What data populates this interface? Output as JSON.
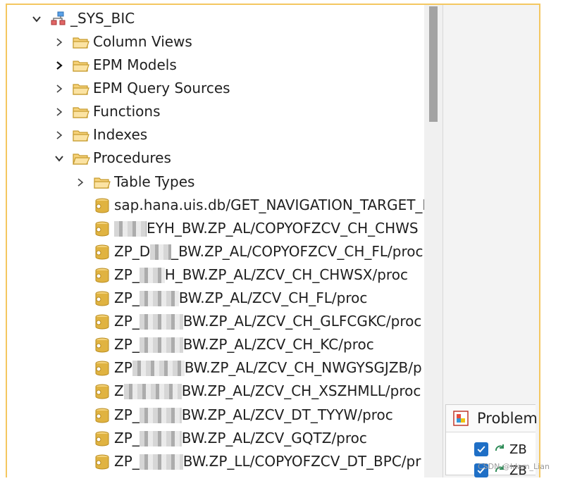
{
  "tree": {
    "root_label": "_SYS_BIC",
    "folders": [
      {
        "label": "Column Views",
        "state": "collapsed"
      },
      {
        "label": "EPM Models",
        "state": "collapsed"
      },
      {
        "label": "EPM Query Sources",
        "state": "collapsed"
      },
      {
        "label": "Functions",
        "state": "collapsed"
      },
      {
        "label": "Indexes",
        "state": "collapsed"
      },
      {
        "label": "Procedures",
        "state": "expanded"
      }
    ],
    "subfolder": {
      "label": "Table Types",
      "state": "collapsed"
    },
    "procedures": [
      {
        "prefix": "sap.hana.uis.db/GET_NAVIGATION_TARGET_D",
        "suffix": ""
      },
      {
        "prefix": "",
        "suffix": "EYH_BW.ZP_AL/COPYOFZCV_CH_CHWS"
      },
      {
        "prefix": "ZP_D",
        "suffix": "_BW.ZP_AL/COPYOFZCV_CH_FL/proc"
      },
      {
        "prefix": "ZP_",
        "suffix": "H_BW.ZP_AL/ZCV_CH_CHWSX/proc"
      },
      {
        "prefix": "ZP_",
        "suffix": "BW.ZP_AL/ZCV_CH_FL/proc"
      },
      {
        "prefix": "ZP_",
        "suffix": "BW.ZP_AL/ZCV_CH_GLFCGKC/proc"
      },
      {
        "prefix": "ZP_",
        "suffix": "BW.ZP_AL/ZCV_CH_KC/proc"
      },
      {
        "prefix": "ZP",
        "suffix": "BW.ZP_AL/ZCV_CH_NWGYSGJZB/p"
      },
      {
        "prefix": "Z",
        "suffix": "BW.ZP_AL/ZCV_CH_XSZHMLL/proc"
      },
      {
        "prefix": "ZP_",
        "suffix": "BW.ZP_AL/ZCV_DT_TYYW/proc"
      },
      {
        "prefix": "ZP_",
        "suffix": "BW.ZP_AL/ZCV_GQTZ/proc"
      },
      {
        "prefix": "ZP_",
        "suffix": "BW.ZP_LL/COPYOFZCV_DT_BPC/pr"
      }
    ]
  },
  "problems": {
    "tab_title": "Problem",
    "rows": [
      "ZB",
      "ZB"
    ]
  },
  "watermark": "CSDN @Idam_Lian",
  "colors": {
    "accent_border": "#f4c760",
    "checkbox_blue": "#1f6fc6",
    "folder_fill": "#f6d27a",
    "proc_icon": "#e0b341"
  }
}
